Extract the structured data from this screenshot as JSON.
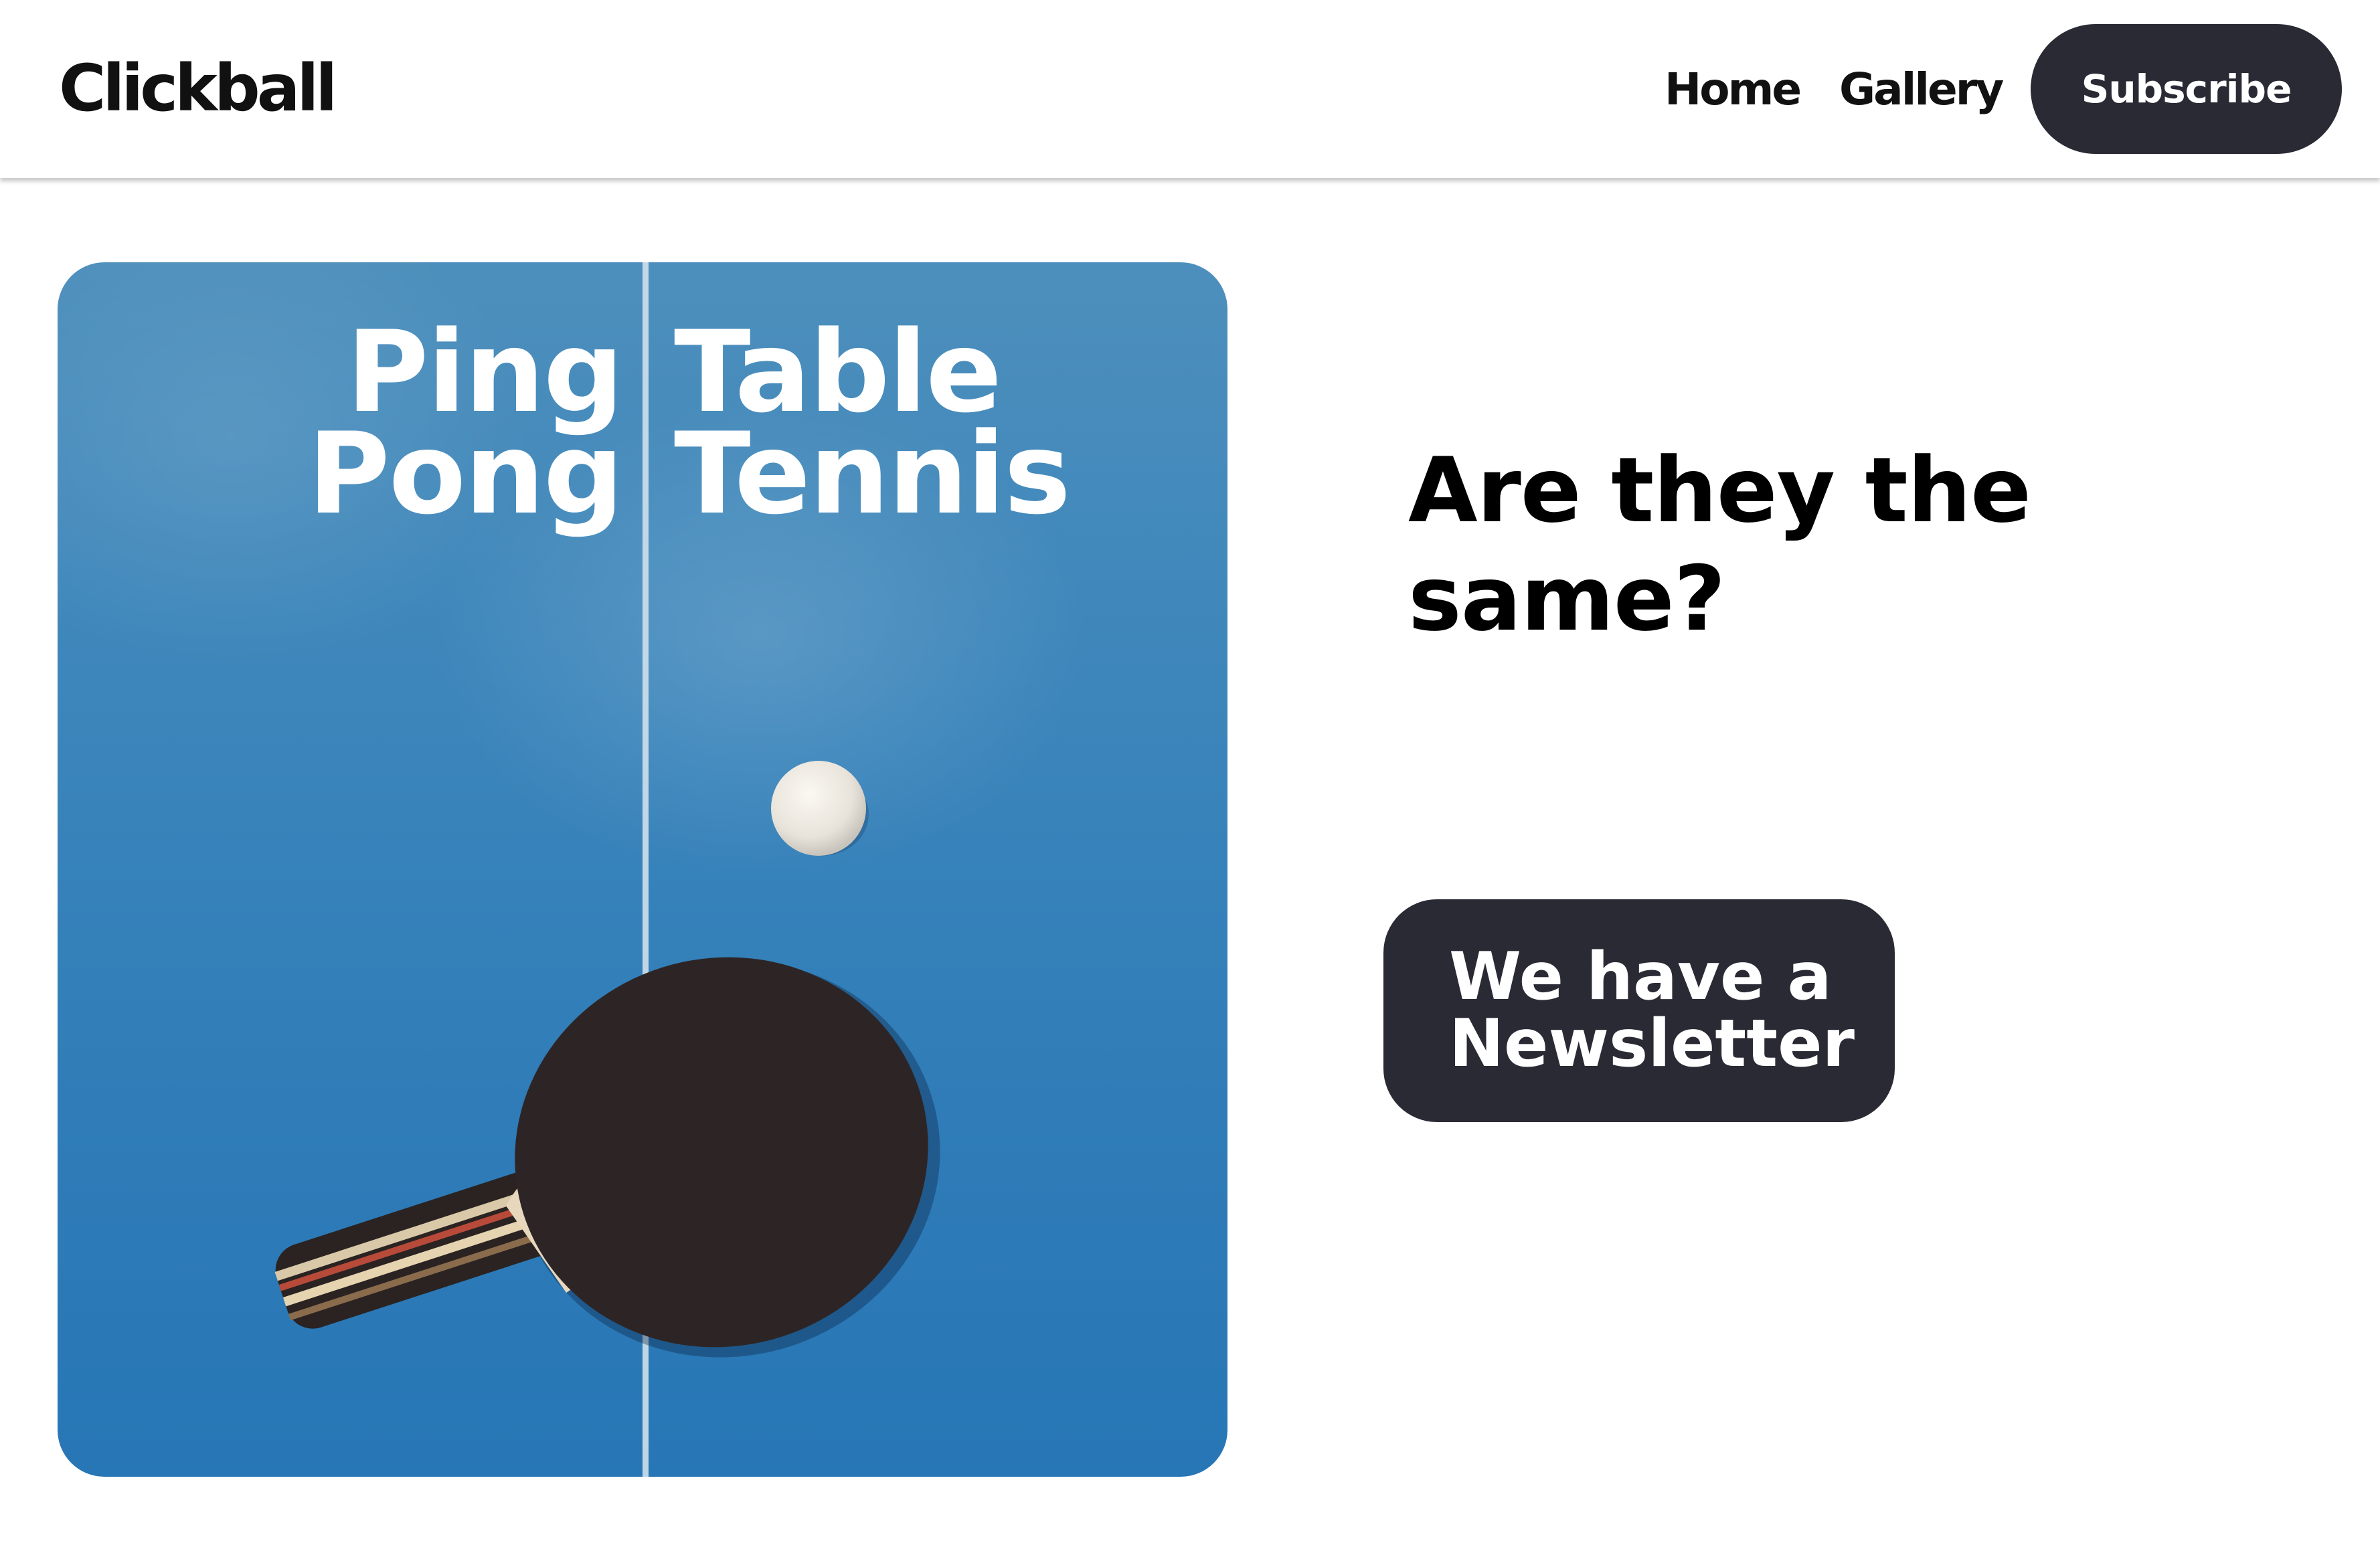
{
  "header": {
    "logo": "Clickball",
    "nav": [
      {
        "label": "Home"
      },
      {
        "label": "Gallery"
      }
    ],
    "subscribe_label": "Subscribe"
  },
  "hero": {
    "left_lines": [
      "Ping",
      "Pong"
    ],
    "right_lines": [
      "Table",
      "Tennis"
    ],
    "table_color": "#3b85bb"
  },
  "main": {
    "headline": "Are they the same?",
    "newsletter_lines": [
      "We have a",
      "Newsletter"
    ]
  },
  "colors": {
    "button_bg": "#2a2a35",
    "text": "#000000"
  }
}
